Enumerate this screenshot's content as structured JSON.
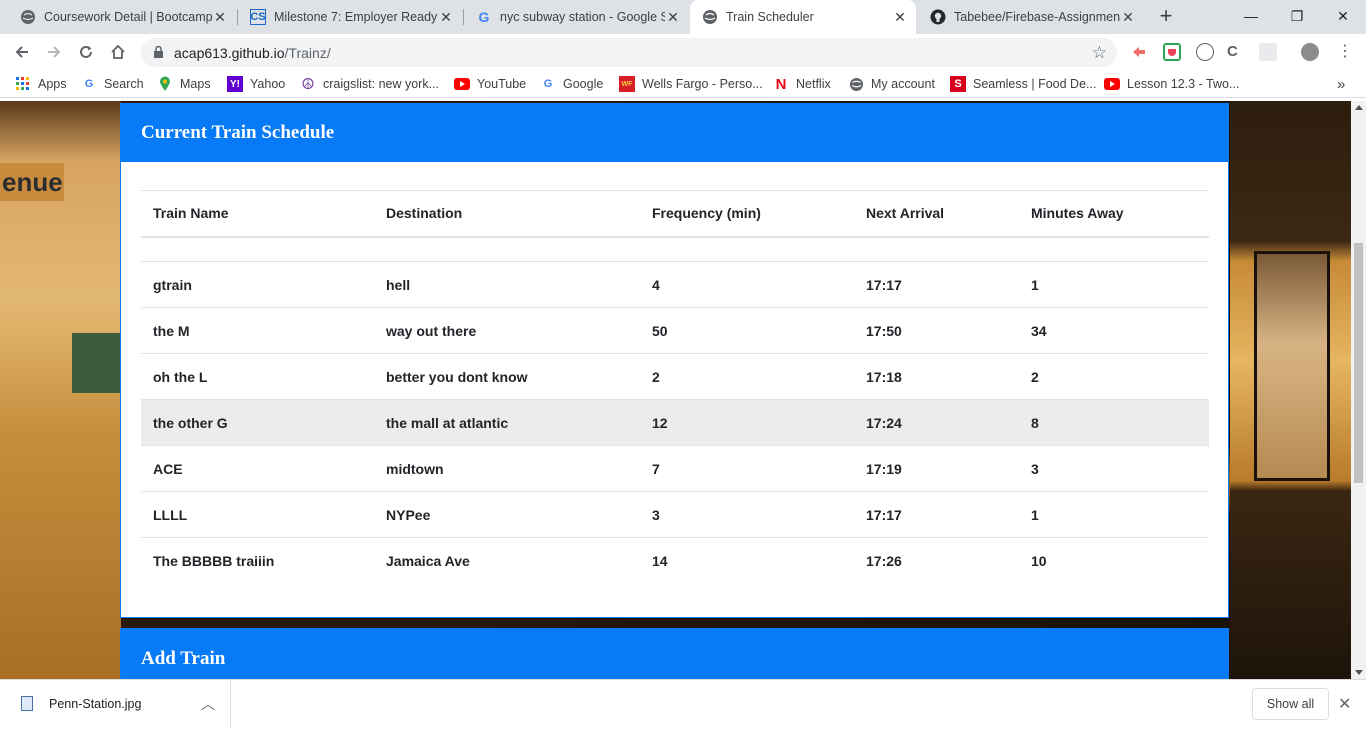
{
  "browser": {
    "tabs": [
      {
        "title": "Coursework Detail | Bootcamp",
        "icon": "globe-icon"
      },
      {
        "title": "Milestone 7: Employer Ready",
        "icon": "cs-icon"
      },
      {
        "title": "nyc subway station - Google Se",
        "icon": "google-icon"
      },
      {
        "title": "Train Scheduler",
        "icon": "globe-icon",
        "active": true
      },
      {
        "title": "Tabebee/Firebase-Assignment",
        "icon": "github-icon"
      }
    ],
    "new_tab_label": "+",
    "close_label": "✕",
    "window": {
      "minimize": "—",
      "maximize": "❐",
      "close": "✕"
    },
    "url_host": "acap613.github.io",
    "url_path": "/Trainz/",
    "bookmarks": [
      {
        "label": "Apps",
        "icon": "apps-icon"
      },
      {
        "label": "Search",
        "icon": "google-icon"
      },
      {
        "label": "Maps",
        "icon": "maps-icon"
      },
      {
        "label": "Yahoo",
        "icon": "yahoo-icon"
      },
      {
        "label": "craigslist: new york...",
        "icon": "peace-icon"
      },
      {
        "label": "YouTube",
        "icon": "youtube-icon"
      },
      {
        "label": "Google",
        "icon": "google-icon"
      },
      {
        "label": "Wells Fargo - Perso...",
        "icon": "wellsfargo-icon"
      },
      {
        "label": "Netflix",
        "icon": "netflix-icon"
      },
      {
        "label": "My account",
        "icon": "globe-icon"
      },
      {
        "label": "Seamless | Food De...",
        "icon": "seamless-icon"
      },
      {
        "label": "Lesson 12.3 - Two...",
        "icon": "youtube-icon"
      }
    ],
    "bookmarks_more": "»"
  },
  "page": {
    "background_sign": "enue",
    "schedule": {
      "heading": "Current Train Schedule",
      "columns": [
        "Train Name",
        "Destination",
        "Frequency (min)",
        "Next Arrival",
        "Minutes Away"
      ],
      "rows": [
        [
          "gtrain",
          "hell",
          "4",
          "17:17",
          "1"
        ],
        [
          "the M",
          "way out there",
          "50",
          "17:50",
          "34"
        ],
        [
          "oh the L",
          "better you dont know",
          "2",
          "17:18",
          "2"
        ],
        [
          "the other G",
          "the mall at atlantic",
          "12",
          "17:24",
          "8"
        ],
        [
          "ACE",
          "midtown",
          "7",
          "17:19",
          "3"
        ],
        [
          "LLLL",
          "NYPee",
          "3",
          "17:17",
          "1"
        ],
        [
          "The BBBBB traiiin",
          "Jamaica Ave",
          "14",
          "17:26",
          "10"
        ]
      ]
    },
    "add_train": {
      "heading": "Add Train"
    }
  },
  "downloads": {
    "file_name": "Penn-Station.jpg",
    "show_all": "Show all",
    "close": "✕"
  },
  "colors": {
    "panel_header": "#067af7",
    "row_highlight": "#ececec"
  }
}
